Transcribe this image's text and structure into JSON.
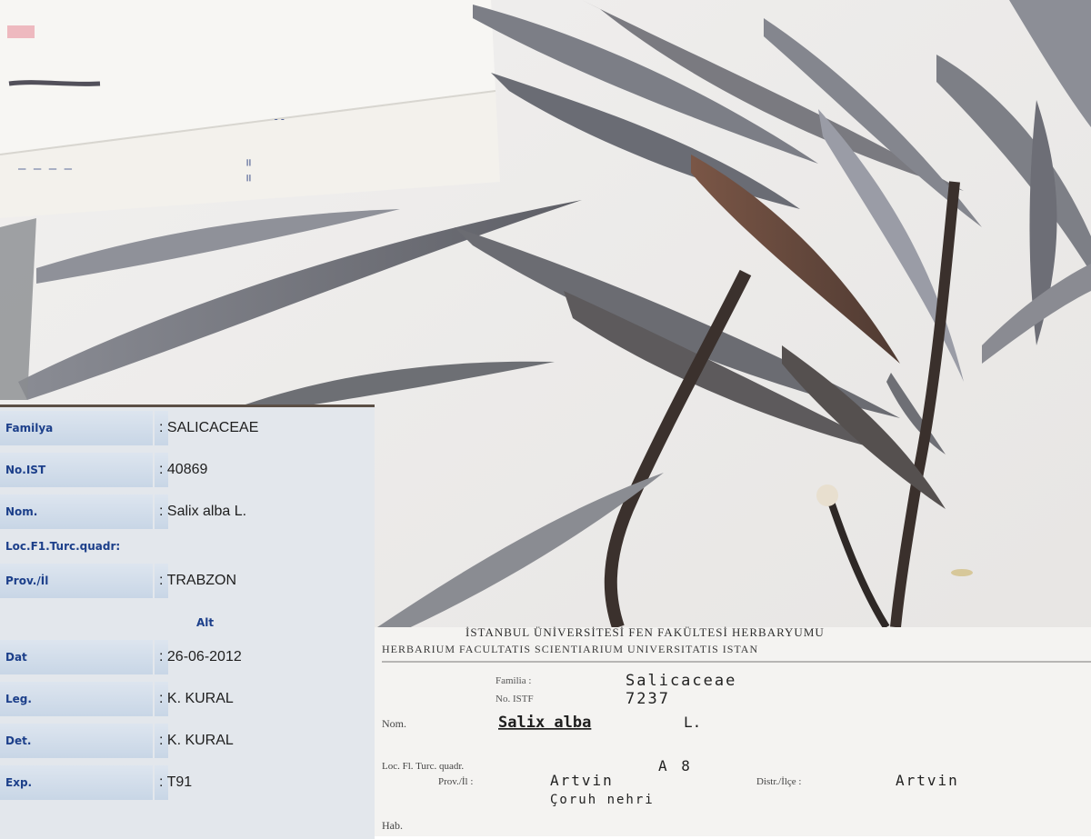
{
  "panel": {
    "rows": [
      {
        "label": "Familya",
        "value": ": SALICACEAE"
      },
      {
        "label": "No.IST",
        "value": ": 40869"
      },
      {
        "label": "Nom.",
        "value": ": Salix alba L."
      },
      {
        "label": "Loc.F1.Turc.quadr:"
      },
      {
        "label": "Prov./İl",
        "value": ": TRABZON"
      },
      {
        "alt": "Alt"
      },
      {
        "label": "Dat",
        "value": ": 26-06-2012"
      },
      {
        "label": "Leg.",
        "value": ": K. KURAL"
      },
      {
        "label": "Det.",
        "value": ": K. KURAL"
      },
      {
        "label": "Exp.",
        "value": ": T91"
      }
    ]
  },
  "specimen_label": {
    "header_line1": "İSTANBUL ÜNİVERSİTESİ FEN FAKÜLTESİ HERBARYUMU",
    "header_line2": "HERBARIUM FACULTATIS SCIENTIARIUM UNIVERSITATIS ISTAN",
    "familia_label": "Familia :",
    "familia_value": "Salicaceae",
    "no_label": "No. ISTF",
    "no_value": "7237",
    "nom_label": "Nom.",
    "nom_value": "Salix alba",
    "nom_author": "L.",
    "loc_label": "Loc.  Fl. Turc. quadr.",
    "loc_value": "A 8",
    "prov_label": "Prov./İl :",
    "prov_value": "Artvin",
    "distr_label": "Distr./İlçe :",
    "distr_value": "Artvin",
    "place_value": "Çoruh nehri",
    "hab_label": "Hab."
  },
  "colors": {
    "label_text": "#1c3f8a",
    "panel_bg": "#e3e7ec",
    "leaf_gray": "#7c7f88",
    "stem_dark": "#3a2e28"
  }
}
